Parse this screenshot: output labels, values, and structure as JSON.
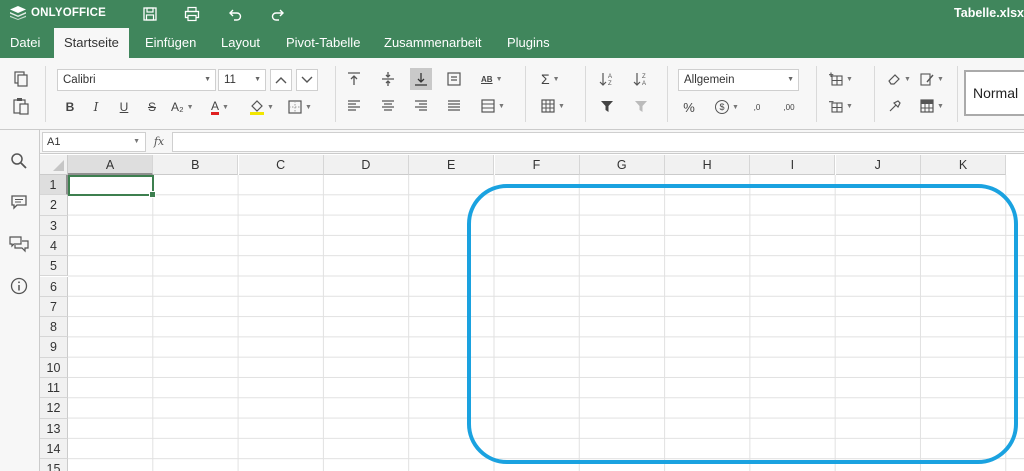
{
  "app": {
    "brand": "ONLYOFFICE",
    "document_title": "Tabelle.xlsx",
    "accent_color": "#40865c",
    "highlight_color": "#1aa2e0"
  },
  "titlebar_icons": [
    "save-icon",
    "print-icon",
    "undo-icon",
    "redo-icon"
  ],
  "menu": {
    "tabs": [
      {
        "label": "Datei",
        "active": false
      },
      {
        "label": "Startseite",
        "active": true
      },
      {
        "label": "Einfügen",
        "active": false
      },
      {
        "label": "Layout",
        "active": false
      },
      {
        "label": "Pivot-Tabelle",
        "active": false
      },
      {
        "label": "Zusammenarbeit",
        "active": false
      },
      {
        "label": "Plugins",
        "active": false
      }
    ]
  },
  "ribbon": {
    "font_name": "Calibri",
    "font_size": "11",
    "bold_label": "B",
    "italic_label": "I",
    "underline_label": "U",
    "strike_label": "S",
    "subscript_label": "A₂",
    "font_color_label": "A",
    "number_format": "Allgemein",
    "percent_label": "%",
    "currency_label": "$",
    "decrease_decimal_label": ",0",
    "increase_decimal_label": ",00",
    "sum_label": "Σ",
    "wrap_label": "AB",
    "style_name": "Normal",
    "font_color": "#e02020",
    "fill_color": "#f2e600"
  },
  "formula_bar": {
    "cell_reference": "A1",
    "fx_label": "fx",
    "formula": ""
  },
  "sidebar_icons": [
    "search-icon",
    "comment-icon",
    "chat-icon",
    "info-icon"
  ],
  "sheet": {
    "columns": [
      "A",
      "B",
      "C",
      "D",
      "E",
      "F",
      "G",
      "H",
      "I",
      "J",
      "K"
    ],
    "rows": [
      "1",
      "2",
      "3",
      "4",
      "5",
      "6",
      "7",
      "8",
      "9",
      "10",
      "11",
      "12",
      "13",
      "14",
      "15"
    ],
    "selected_cell": "A1"
  }
}
